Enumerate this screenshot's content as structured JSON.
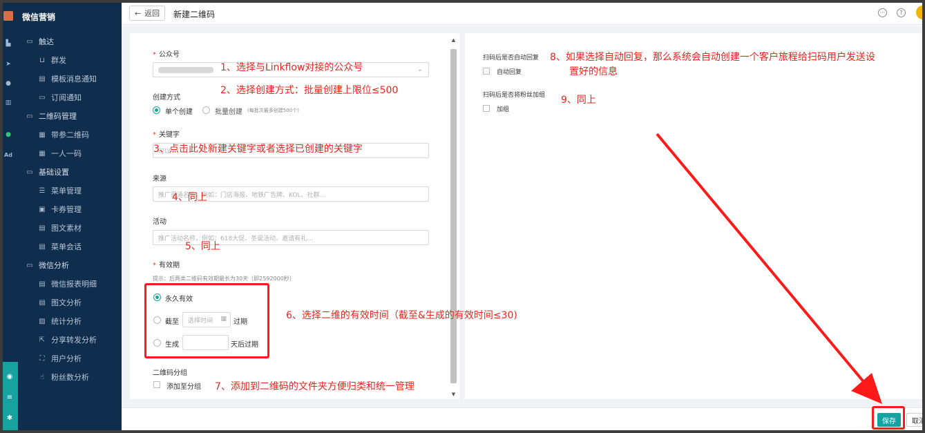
{
  "sidebar": {
    "brand": "微信营销",
    "groups": [
      {
        "label": "触达",
        "items": [
          "群发",
          "模板消息通知",
          "订阅通知"
        ]
      },
      {
        "label": "二维码管理",
        "items": [
          "带参二维码",
          "一人一码"
        ]
      },
      {
        "label": "基础设置",
        "items": [
          "菜单管理",
          "卡券管理",
          "图文素材",
          "菜单会话"
        ]
      },
      {
        "label": "微信分析",
        "items": [
          "微信报表明细",
          "图文分析",
          "统计分析",
          "分享转发分析",
          "用户分析",
          "粉丝数分析"
        ]
      }
    ],
    "rail_text": "Ad"
  },
  "header": {
    "back_label": "返回",
    "title": "新建二维码"
  },
  "form": {
    "account_label": "公众号",
    "create_mode_label": "创建方式",
    "single_create": "单个创建",
    "batch_create": "批量创建",
    "batch_note": "(每批次最多创建500个)",
    "keyword_label": "关键字",
    "keyword_placeholder": "可以",
    "source_label": "来源",
    "source_placeholder": "推广渠道名称，例如：门店海报、地铁广告牌、KOL、社群...",
    "activity_label": "活动",
    "activity_placeholder": "推广活动名称，例如：618大促、圣诞活动、邀请有礼...",
    "validity_label": "有效期",
    "validity_hint": "提示：后两类二维码有效期最长为30天（即2592000秒）",
    "forever": "永久有效",
    "until": "截至",
    "select_time": "选择时间",
    "expire": "过期",
    "generate": "生成",
    "days_after_expire": "天后过期",
    "group_label": "二维码分组",
    "add_to_group": "添加至分组"
  },
  "right": {
    "auto_reply_label": "扫码后是否自动回复",
    "auto_reply_option": "自动回复",
    "add_tag_label": "扫码后是否将粉丝加组",
    "add_tag_option": "加组"
  },
  "footer": {
    "save": "保存",
    "cancel": "取消"
  },
  "annotations": {
    "a1": "1、选择与Linkflow对接的公众号",
    "a2": "2、选择创建方式：批量创建上限位≤500",
    "a3": "3、点击此处新建关键字或者选择已创建的关键字",
    "a4": "4、同上",
    "a5": "5、同上",
    "a6": "6、选择二维的有效时间（截至&生成的有效时间≤30)",
    "a7": "7、添加到二维码的文件夹方便归类和统一管理",
    "a8_line1": "8、如果选择自动回复，那么系统会自动创建一个客户旅程给扫码用户发送设",
    "a8_line2": "置好的信息",
    "a9": "9、同上"
  },
  "colors": {
    "sidebar_bg": "#0f2d4d",
    "accent": "#17a2a2",
    "annotation": "#e8261d"
  }
}
